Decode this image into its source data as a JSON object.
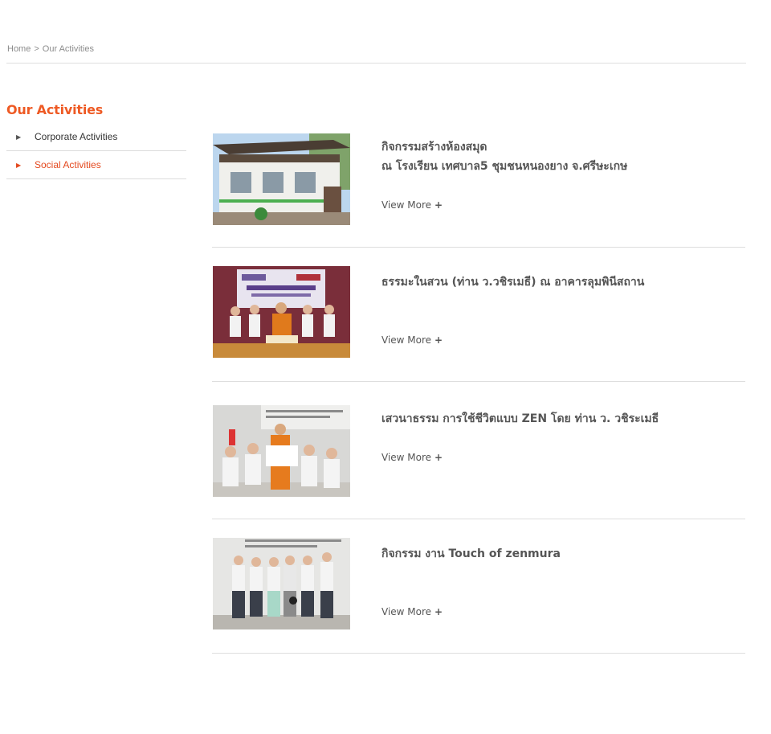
{
  "breadcrumb": {
    "home": "Home",
    "separator": ">",
    "current": "Our Activities"
  },
  "sidebar": {
    "title": "Our Activities",
    "items": [
      {
        "label": "Corporate Activities",
        "active": false
      },
      {
        "label": "Social Activities",
        "active": true
      }
    ]
  },
  "activities": [
    {
      "title_line1": "กิจกรรมสร้างห้องสมุด",
      "title_line2": "ณ โรงเรียน เทศบาล5  ชุมชนหนองยาง จ.ศรีษะเกษ",
      "view_more": "View More",
      "plus": "+",
      "image_icon": "school-building-photo"
    },
    {
      "title_line1": "ธรรมะในสวน (ท่าน ว.วชิรเมธี) ณ อาคารลุมพินีสถาน",
      "title_line2": "",
      "view_more": "View More",
      "plus": "+",
      "image_icon": "monk-group-photo"
    },
    {
      "title_line1": "เสวนาธรรม การใช้ชีวิตแบบ ZEN โดย ท่าน ว. วชิระเมธี",
      "title_line2": "",
      "view_more": "View More",
      "plus": "+",
      "image_icon": "zen-talk-photo"
    },
    {
      "title_line1": "กิจกรรม งาน Touch of zenmura",
      "title_line2": "",
      "view_more": "View More",
      "plus": "+",
      "image_icon": "zenmura-group-photo"
    }
  ],
  "colors": {
    "accent": "#ee5a24",
    "active_link": "#e4491f",
    "text": "#555555",
    "rule": "#dedede"
  }
}
